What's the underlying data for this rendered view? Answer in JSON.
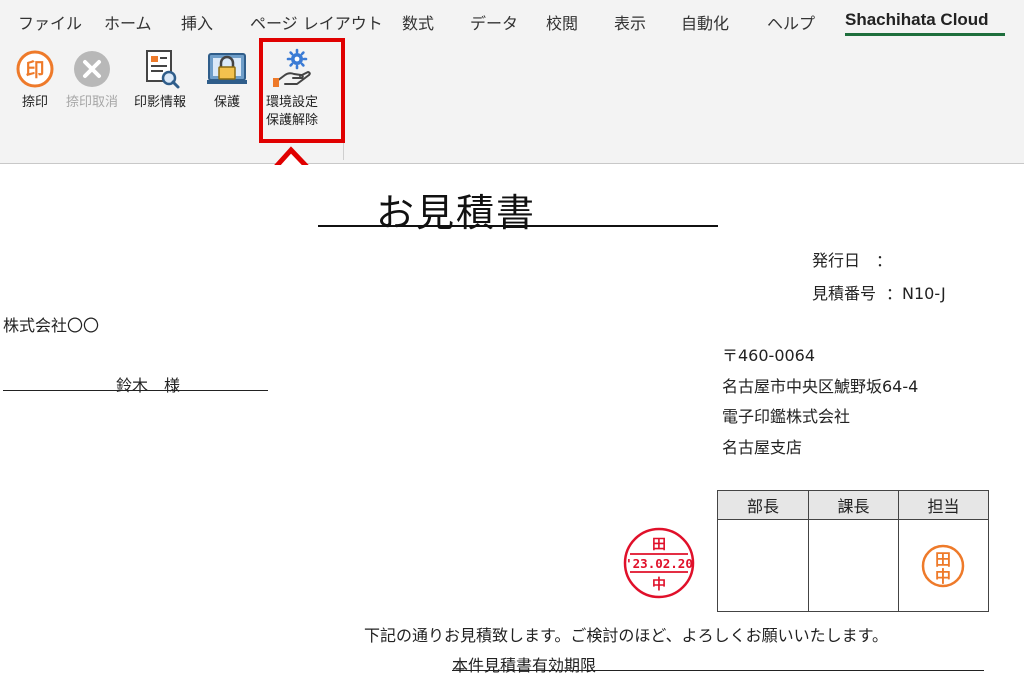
{
  "ribbon": {
    "tabs": [
      {
        "label": "ファイル"
      },
      {
        "label": "ホーム"
      },
      {
        "label": "挿入"
      },
      {
        "label": "ページ レイアウト"
      },
      {
        "label": "数式"
      },
      {
        "label": "データ"
      },
      {
        "label": "校閲"
      },
      {
        "label": "表示"
      },
      {
        "label": "自動化"
      },
      {
        "label": "ヘルプ"
      },
      {
        "label": "Shachihata Cloud",
        "active": true
      }
    ],
    "buttons": {
      "stamp": "捺印",
      "cancel_stamp": "捺印取消",
      "stamp_info": "印影情報",
      "protect": "保護",
      "unprotect_line1": "環境設定",
      "unprotect_line2": "保護解除"
    },
    "stamp_icon_char": "印"
  },
  "document": {
    "title": "お見積書",
    "issue_date_label": "発行日　：",
    "quote_no_label": "見積番号",
    "quote_no_value": "：N10-J",
    "client_company": "株式会社〇〇",
    "client_person": "鈴木　様",
    "sender": {
      "postal": "〒460-0064",
      "address": "名古屋市中央区鯱野坂64-4",
      "company": "電子印鑑株式会社",
      "branch": "名古屋支店"
    },
    "approval_headers": [
      "部長",
      "課長",
      "担当"
    ],
    "message": "下記の通りお見積致します。ご検討のほど、よろしくお願いいたします。",
    "validity_label": "本件見積書有効期限"
  },
  "stamps": {
    "date_stamp": {
      "top": "田",
      "date": "'23.02.20",
      "bottom": "中"
    },
    "name_stamp": {
      "line1": "田",
      "line2": "中"
    }
  },
  "colors": {
    "accent_green": "#1e6e3c",
    "highlight_red": "#e00000",
    "stamp_red": "#e0102a",
    "stamp_orange": "#ee7a2a"
  }
}
